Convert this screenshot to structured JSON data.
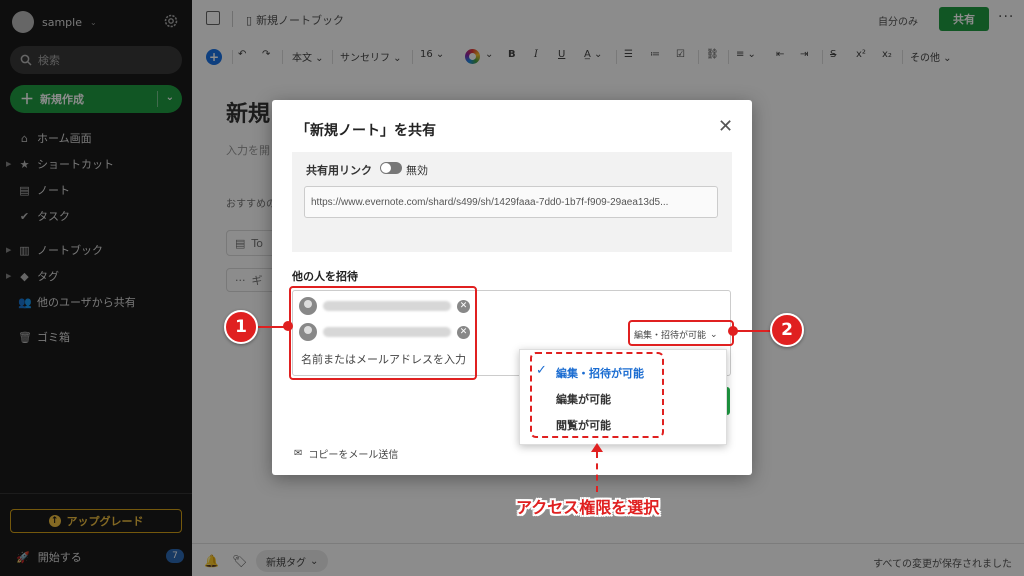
{
  "sidebar": {
    "account_name": "sample",
    "search_placeholder": "検索",
    "new_button": "新規作成",
    "items": [
      {
        "label": "ホーム画面",
        "icon": "home-icon"
      },
      {
        "label": "ショートカット",
        "icon": "star-icon"
      },
      {
        "label": "ノート",
        "icon": "note-icon"
      },
      {
        "label": "タスク",
        "icon": "task-check-icon"
      },
      {
        "label": "ノートブック",
        "icon": "notebook-icon"
      },
      {
        "label": "タグ",
        "icon": "tag-icon"
      },
      {
        "label": "他のユーザから共有",
        "icon": "shared-users-icon"
      },
      {
        "label": "ゴミ箱",
        "icon": "trash-icon"
      }
    ],
    "upgrade": "アップグレード",
    "start": "開始する",
    "start_badge": "7"
  },
  "topbar": {
    "notebook": "新規ノートブック",
    "only_me": "自分のみ",
    "share": "共有"
  },
  "toolbar": {
    "text_style": "本文",
    "font": "サンセリフ",
    "size": "16",
    "more": "その他"
  },
  "note": {
    "title": "新規",
    "placeholder": "入力を開",
    "recommend": "おすすめの",
    "template1": "To",
    "template2": "ギ"
  },
  "bottombar": {
    "new_tag": "新規タグ",
    "saved": "すべての変更が保存されました"
  },
  "modal": {
    "title": "「新規ノート」を共有",
    "link_label": "共有用リンク",
    "toggle_state": "無効",
    "url": "https://www.evernote.com/shard/s499/sh/1429faaa-7dd0-1b7f-f909-29aea13d5...",
    "invite_label": "他の人を招待",
    "invite_placeholder": "名前またはメールアドレスを入力",
    "permission": "編集・招待が可能",
    "copy_mail": "コピーをメール送信"
  },
  "dropdown": {
    "options": [
      "編集・招待が可能",
      "編集が可能",
      "閲覧が可能"
    ],
    "selected": "編集・招待が可能"
  },
  "annotations": {
    "marker1": "1",
    "marker2": "2",
    "caption": "アクセス権限を選択"
  },
  "colors": {
    "brand_green": "#1f9d43",
    "annotation_red": "#e02020",
    "selected_blue": "#1a6cd1"
  }
}
